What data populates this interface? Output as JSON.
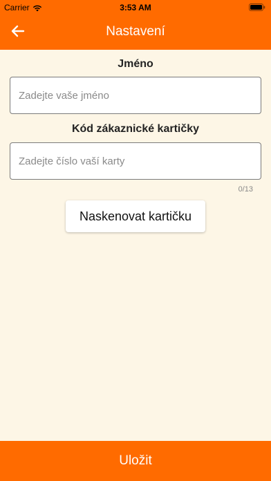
{
  "status_bar": {
    "carrier": "Carrier",
    "time": "3:53 AM"
  },
  "header": {
    "title": "Nastavení",
    "back_icon": "arrow-left-icon"
  },
  "form": {
    "name": {
      "label": "Jméno",
      "placeholder": "Zadejte vaše jméno",
      "value": ""
    },
    "card": {
      "label": "Kód zákaznické kartičky",
      "placeholder": "Zadejte číslo vaší karty",
      "value": "",
      "counter": "0/13"
    },
    "scan_button_label": "Naskenovat kartičku"
  },
  "footer": {
    "save_label": "Uložit"
  },
  "colors": {
    "accent": "#ff6b00",
    "background": "#fdf6e6"
  }
}
